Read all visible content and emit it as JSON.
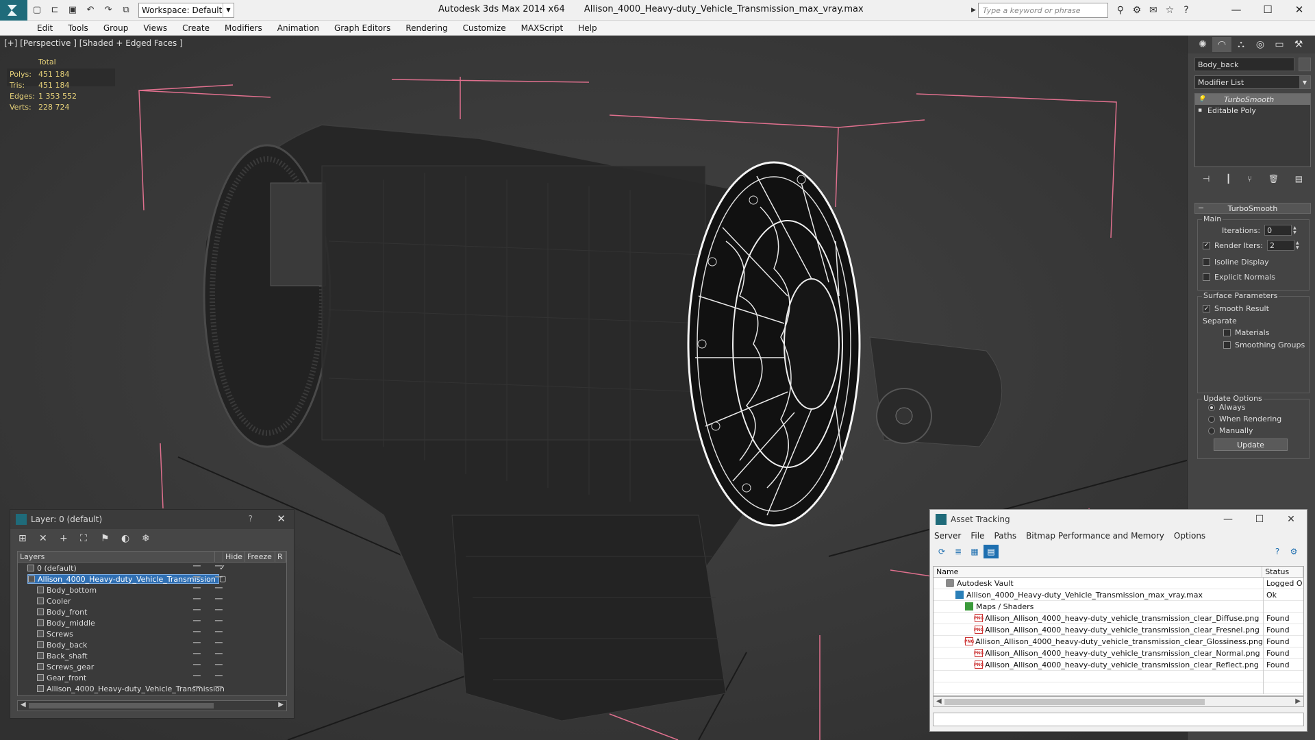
{
  "window": {
    "app_title": "Autodesk 3ds Max  2014 x64",
    "file_title": "Allison_4000_Heavy-duty_Vehicle_Transmission_max_vray.max",
    "workspace_label": "Workspace: Default",
    "search_placeholder": "Type a keyword or phrase"
  },
  "menu": [
    "Edit",
    "Tools",
    "Group",
    "Views",
    "Create",
    "Modifiers",
    "Animation",
    "Graph Editors",
    "Rendering",
    "Customize",
    "MAXScript",
    "Help"
  ],
  "viewport": {
    "label": "[+] [Perspective ] [Shaded + Edged Faces ]",
    "stats": {
      "header": "Total",
      "rows": [
        {
          "key": "Polys:",
          "value": "451 184"
        },
        {
          "key": "Tris:",
          "value": "451 184"
        },
        {
          "key": "Edges:",
          "value": "1 353 552"
        },
        {
          "key": "Verts:",
          "value": "228 724"
        }
      ]
    }
  },
  "command_panel": {
    "object_name": "Body_back",
    "modifier_list": "Modifier List",
    "stack": [
      "TurboSmooth",
      "Editable Poly"
    ],
    "rollout_title": "TurboSmooth",
    "main_group": "Main",
    "iterations_label": "Iterations:",
    "iterations_value": "0",
    "render_iters_label": "Render Iters:",
    "render_iters_value": "2",
    "isoline_label": "Isoline Display",
    "explicit_normals_label": "Explicit Normals",
    "surface_group": "Surface Parameters",
    "smooth_result_label": "Smooth Result",
    "separate_label": "Separate",
    "materials_label": "Materials",
    "smoothing_groups_label": "Smoothing Groups",
    "update_group": "Update Options",
    "always_label": "Always",
    "when_rendering_label": "When Rendering",
    "manually_label": "Manually",
    "update_button": "Update"
  },
  "layer_dialog": {
    "title": "Layer: 0 (default)",
    "help": "?",
    "columns": [
      "Layers",
      "Hide",
      "Freeze",
      "R"
    ],
    "rows": [
      {
        "name": "0 (default)",
        "indent": 1,
        "selected": false
      },
      {
        "name": "Allison_4000_Heavy-duty_Vehicle_Transmission",
        "indent": 1,
        "selected": true
      },
      {
        "name": "Body_bottom",
        "indent": 2,
        "selected": false
      },
      {
        "name": "Cooler",
        "indent": 2,
        "selected": false
      },
      {
        "name": "Body_front",
        "indent": 2,
        "selected": false
      },
      {
        "name": "Body_middle",
        "indent": 2,
        "selected": false
      },
      {
        "name": "Screws",
        "indent": 2,
        "selected": false
      },
      {
        "name": "Body_back",
        "indent": 2,
        "selected": false
      },
      {
        "name": "Back_shaft",
        "indent": 2,
        "selected": false
      },
      {
        "name": "Screws_gear",
        "indent": 2,
        "selected": false
      },
      {
        "name": "Gear_front",
        "indent": 2,
        "selected": false
      },
      {
        "name": "Allison_4000_Heavy-duty_Vehicle_Transmission",
        "indent": 2,
        "selected": false
      }
    ]
  },
  "asset_dialog": {
    "title": "Asset Tracking",
    "menu": [
      "Server",
      "File",
      "Paths",
      "Bitmap Performance and Memory",
      "Options"
    ],
    "columns": [
      "Name",
      "Status"
    ],
    "rows": [
      {
        "name": "Autodesk Vault",
        "status": "Logged O",
        "level": 0,
        "icon": "vault"
      },
      {
        "name": "Allison_4000_Heavy-duty_Vehicle_Transmission_max_vray.max",
        "status": "Ok",
        "level": 1,
        "icon": "max"
      },
      {
        "name": "Maps / Shaders",
        "status": "",
        "level": 2,
        "icon": "maps"
      },
      {
        "name": "Allison_Allison_4000_heavy-duty_vehicle_transmission_clear_Diffuse.png",
        "status": "Found",
        "level": 3,
        "icon": "png"
      },
      {
        "name": "Allison_Allison_4000_heavy-duty_vehicle_transmission_clear_Fresnel.png",
        "status": "Found",
        "level": 3,
        "icon": "png"
      },
      {
        "name": "Allison_Allison_4000_heavy-duty_vehicle_transmission_clear_Glossiness.png",
        "status": "Found",
        "level": 3,
        "icon": "png"
      },
      {
        "name": "Allison_Allison_4000_heavy-duty_vehicle_transmission_clear_Normal.png",
        "status": "Found",
        "level": 3,
        "icon": "png"
      },
      {
        "name": "Allison_Allison_4000_heavy-duty_vehicle_transmission_clear_Reflect.png",
        "status": "Found",
        "level": 3,
        "icon": "png"
      }
    ]
  },
  "colors": {
    "viewport_bg": "#383838",
    "selection": "#2f6fb3",
    "stat_text": "#e7d27a",
    "bbox": "#e0708e"
  }
}
